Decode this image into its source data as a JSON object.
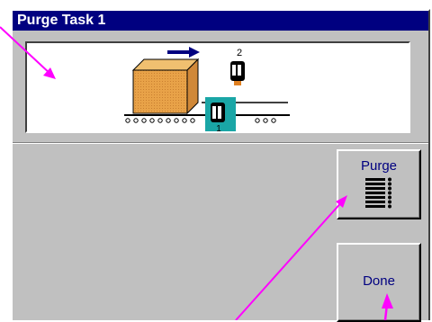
{
  "window": {
    "title": "Purge Task 1"
  },
  "illustration": {
    "printhead_top_label": "2",
    "printhead_bottom_label": "1"
  },
  "buttons": {
    "purge_label": "Purge",
    "done_label": "Done"
  },
  "colors": {
    "titlebar": "#000080",
    "window_face": "#c0c0c0",
    "annotation_arrow": "#ff00ff",
    "box_fill": "#e8a248",
    "printhead_highlight": "#1aa6a6"
  },
  "icons": {
    "purge_icon": "lines-with-dots",
    "direction_arrow": "right-arrow"
  }
}
